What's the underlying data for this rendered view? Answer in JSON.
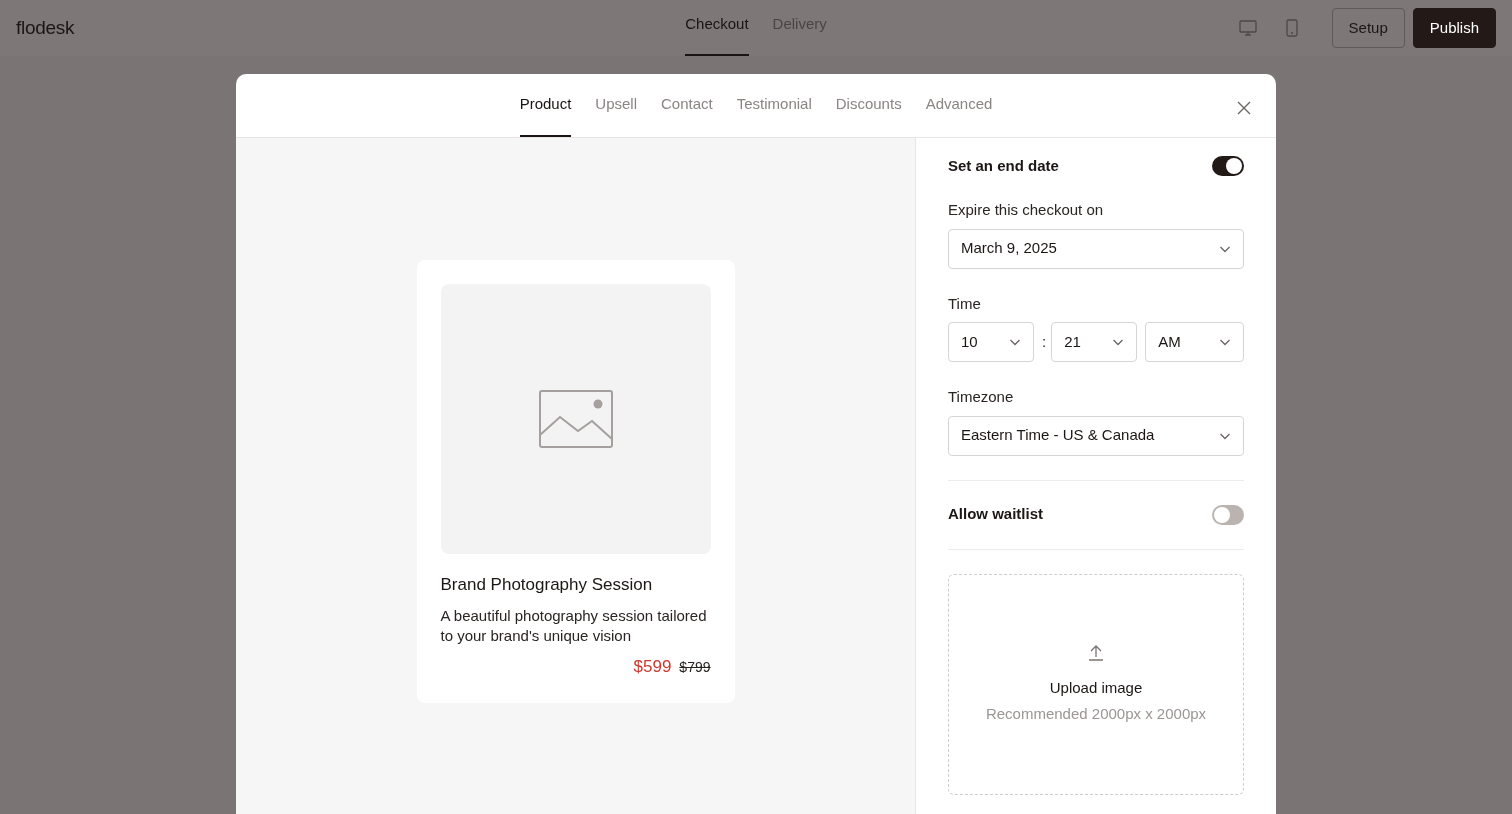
{
  "header": {
    "logo": "flodesk",
    "tabs": [
      {
        "label": "Checkout",
        "selected": true
      },
      {
        "label": "Delivery",
        "selected": false
      }
    ],
    "devices": [
      {
        "kind": "desktop",
        "selected": false
      },
      {
        "kind": "phone",
        "selected": false
      }
    ],
    "buttons": [
      {
        "label": "Setup",
        "kind": "outline"
      },
      {
        "label": "Publish",
        "kind": "primary"
      }
    ]
  },
  "modal": {
    "tabs": [
      {
        "label": "Product",
        "selected": true
      },
      {
        "label": "Upsell",
        "selected": false
      },
      {
        "label": "Contact",
        "selected": false
      },
      {
        "label": "Testimonial",
        "selected": false
      },
      {
        "label": "Discounts",
        "selected": false
      },
      {
        "label": "Advanced",
        "selected": false
      }
    ],
    "product": {
      "title": "Brand Photography Session",
      "description": "A beautiful photography session tailored to your brand's unique vision",
      "price": "$599",
      "original_price": "$799"
    },
    "settings": {
      "end_date": {
        "label": "Set an end date",
        "on": true
      },
      "expire_label": "Expire this checkout on",
      "date": "March 9, 2025",
      "time_label": "Time",
      "hour": "10",
      "separator": ":",
      "minute": "21",
      "period": "AM",
      "timezone_label": "Timezone",
      "timezone": "Eastern Time - US & Canada",
      "waitlist": {
        "label": "Allow waitlist",
        "on": false
      },
      "upload": {
        "label": "Upload image",
        "hint": "Recommended 2000px x 2000px"
      }
    }
  }
}
